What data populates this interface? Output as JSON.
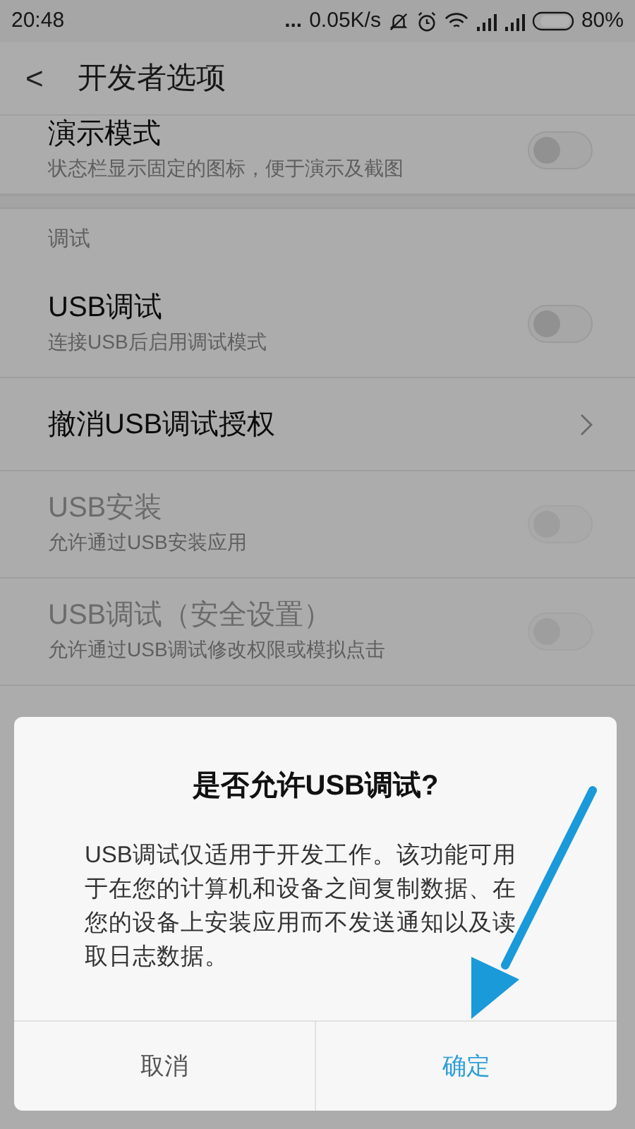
{
  "status_bar": {
    "time": "20:48",
    "dots": "...",
    "speed": "0.05K/s",
    "battery": "80%"
  },
  "header": {
    "back": "<",
    "title": "开发者选项"
  },
  "rows": [
    {
      "kind": "toggle",
      "title": "演示模式",
      "subtitle": "状态栏显示固定的图标，便于演示及截图",
      "checked": false,
      "disabled": false
    },
    {
      "kind": "section",
      "title": "调试"
    },
    {
      "kind": "toggle",
      "title": "USB调试",
      "subtitle": "连接USB后启用调试模式",
      "checked": false,
      "disabled": false
    },
    {
      "kind": "link",
      "title": "撤消USB调试授权"
    },
    {
      "kind": "toggle",
      "title": "USB安装",
      "subtitle": "允许通过USB安装应用",
      "checked": false,
      "disabled": true
    },
    {
      "kind": "toggle",
      "title": "USB调试（安全设置）",
      "subtitle": "允许通过USB调试修改权限或模拟点击",
      "checked": false,
      "disabled": true
    }
  ],
  "dialog": {
    "title": "是否允许USB调试?",
    "message": "USB调试仅适用于开发工作。该功能可用于在您的计算机和设备之间复制数据、在您的设备上安装应用而不发送通知以及读取日志数据。",
    "buttons": [
      {
        "label": "取消",
        "primary": false
      },
      {
        "label": "确定",
        "primary": true
      }
    ]
  }
}
